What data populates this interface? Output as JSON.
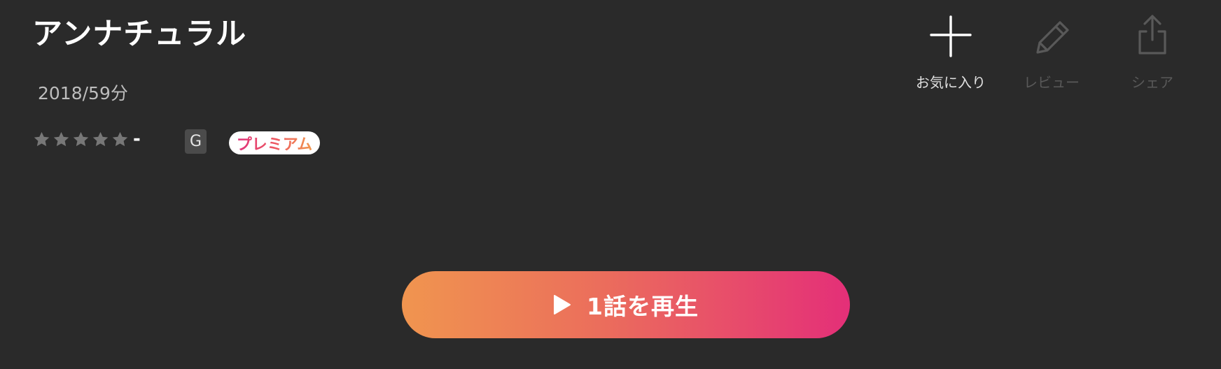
{
  "title": "アンナチュラル",
  "meta": "2018/59分",
  "rating": {
    "stars_filled": 0,
    "stars_total": 5,
    "value": "-"
  },
  "age_rating": "G",
  "premium_label": "プレミアム",
  "actions": {
    "favorite": {
      "label": "お気に入り",
      "icon": "plus-icon",
      "enabled": true
    },
    "review": {
      "label": "レビュー",
      "icon": "pencil-icon",
      "enabled": false
    },
    "share": {
      "label": "シェア",
      "icon": "share-icon",
      "enabled": false
    }
  },
  "play_button": {
    "label": "1話を再生",
    "icon": "play-icon"
  },
  "colors": {
    "background": "#2a2a2a",
    "star_empty": "#777777",
    "gradient_start": "#f0954f",
    "gradient_end": "#e42f78",
    "disabled": "#595959"
  }
}
